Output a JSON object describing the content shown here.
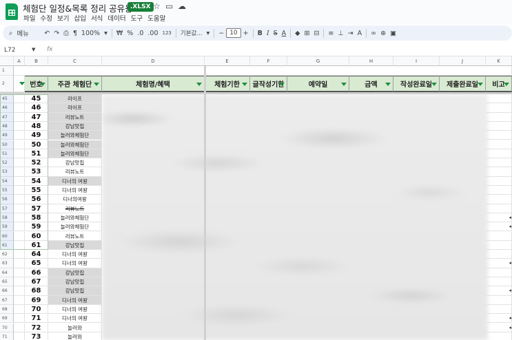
{
  "title_bar": {
    "doc_title": "체험단 일정&목록 정리 공유용",
    "badge": ".XLSX",
    "icons": [
      "star-icon",
      "folder-icon",
      "cloud-icon"
    ]
  },
  "menu": [
    "파일",
    "수정",
    "보기",
    "삽입",
    "서식",
    "데이터",
    "도구",
    "도움말"
  ],
  "toolbar": {
    "search": "메뉴",
    "zoom": "100%",
    "currency": "₩",
    "percent": "%",
    "dec_less": ".0",
    "dec_more": ".00",
    "format_123": "123",
    "font": "기본값...",
    "font_size": "10",
    "bold": "B",
    "italic": "I",
    "strike": "S",
    "text_color": "A"
  },
  "formula_bar": {
    "cell_ref": "L72",
    "fx": "fx"
  },
  "columns": [
    "A",
    "B",
    "C",
    "D",
    "E",
    "F",
    "G",
    "H",
    "I",
    "J",
    "K"
  ],
  "headers": {
    "num": "번호",
    "group": "주관 체험단",
    "name": "체험명/혜택",
    "deadline": "체험기한",
    "write_deadline": "글작성기한",
    "reservation": "예약일",
    "amount": "금액",
    "write_done": "작성완료일",
    "submit_done": "제출완료일",
    "note": "비고"
  },
  "row_top_numbers": [
    "1",
    "2"
  ],
  "rows": [
    {
      "row": "45",
      "num": "45",
      "group": "라이프",
      "grey": true,
      "strike": false
    },
    {
      "row": "46",
      "num": "46",
      "group": "라이프",
      "grey": true,
      "strike": false
    },
    {
      "row": "47",
      "num": "47",
      "group": "리뷰노트",
      "grey": true,
      "strike": false
    },
    {
      "row": "48",
      "num": "48",
      "group": "강남맛집",
      "grey": true,
      "strike": false
    },
    {
      "row": "49",
      "num": "49",
      "group": "놀러와체험단",
      "grey": true,
      "strike": false
    },
    {
      "row": "50",
      "num": "50",
      "group": "놀러와체험단",
      "grey": true,
      "strike": false
    },
    {
      "row": "51",
      "num": "51",
      "group": "놀러와체험단",
      "grey": true,
      "strike": false
    },
    {
      "row": "52",
      "num": "52",
      "group": "강남맛집",
      "grey": false,
      "strike": false
    },
    {
      "row": "53",
      "num": "53",
      "group": "리뷰노트",
      "grey": false,
      "strike": false
    },
    {
      "row": "54",
      "num": "54",
      "group": "디너의 여왕",
      "grey": true,
      "strike": false
    },
    {
      "row": "55",
      "num": "55",
      "group": "디너의 여왕",
      "grey": false,
      "strike": false
    },
    {
      "row": "56",
      "num": "56",
      "group": "디너의여왕",
      "grey": false,
      "strike": false
    },
    {
      "row": "57",
      "num": "57",
      "group": "리뷰노트",
      "grey": false,
      "strike": true
    },
    {
      "row": "58",
      "num": "58",
      "group": "놀러와체험단",
      "grey": false,
      "strike": false
    },
    {
      "row": "59",
      "num": "59",
      "group": "놀러와체험단",
      "grey": false,
      "strike": false
    },
    {
      "row": "60",
      "num": "60",
      "group": "리뷰노트",
      "grey": false,
      "strike": false
    },
    {
      "row": "61",
      "num": "61",
      "group": "강남맛집",
      "grey": true,
      "strike": false
    },
    {
      "row": "62",
      "num": "64",
      "group": "디너의 여왕",
      "grey": false,
      "strike": false
    },
    {
      "row": "63",
      "num": "65",
      "group": "디너의 여왕",
      "grey": false,
      "strike": false
    },
    {
      "row": "64",
      "num": "66",
      "group": "강남맛집",
      "grey": true,
      "strike": false
    },
    {
      "row": "65",
      "num": "67",
      "group": "강남맛집",
      "grey": true,
      "strike": false
    },
    {
      "row": "66",
      "num": "68",
      "group": "강남맛집",
      "grey": true,
      "strike": false
    },
    {
      "row": "67",
      "num": "69",
      "group": "디너의 여왕",
      "grey": true,
      "strike": false
    },
    {
      "row": "68",
      "num": "70",
      "group": "디너의 여왕",
      "grey": false,
      "strike": false
    },
    {
      "row": "69",
      "num": "71",
      "group": "디너의 여왕",
      "grey": false,
      "strike": false
    },
    {
      "row": "70",
      "num": "72",
      "group": "놀러와",
      "grey": false,
      "strike": false
    },
    {
      "row": "71",
      "num": "73",
      "group": "놀러와",
      "grey": false,
      "strike": false
    }
  ],
  "colors": {
    "header_green": "#d9ead3",
    "filter_green": "#1e8e3e",
    "grey_row": "#d9d9d9",
    "selection": "#1a73e8"
  }
}
